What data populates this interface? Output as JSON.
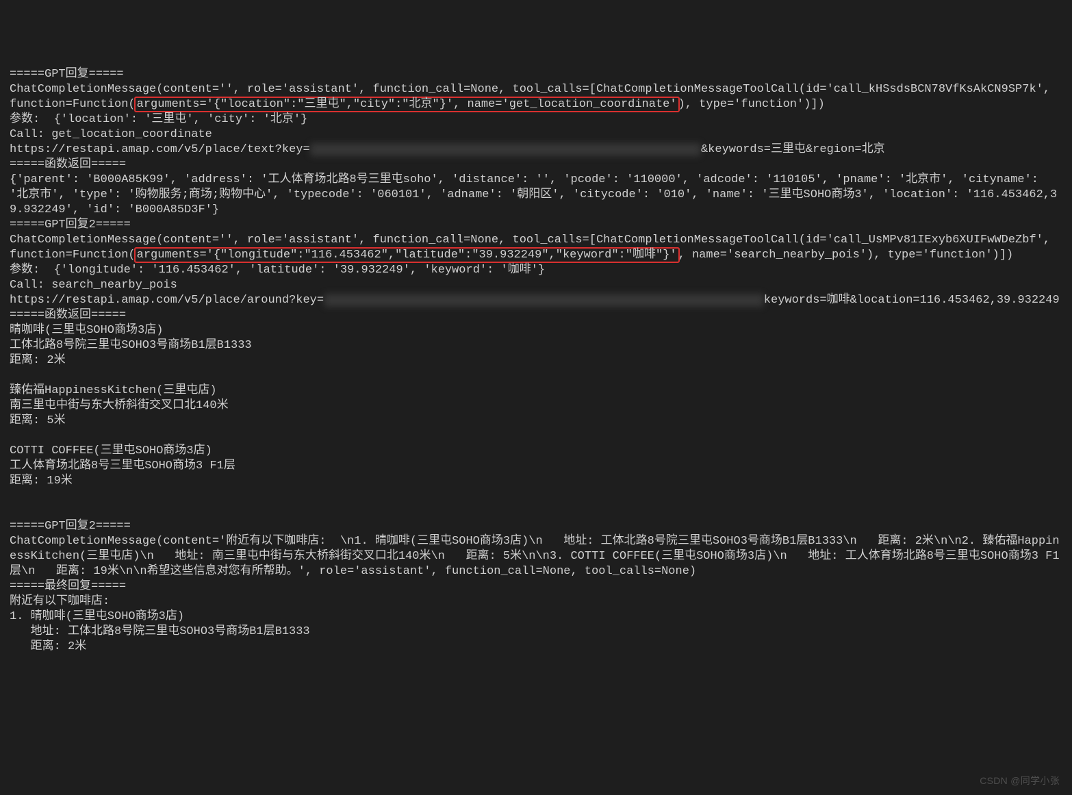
{
  "sections": {
    "gpt1_header": "=====GPT回复=====",
    "gpt1_pre": "ChatCompletionMessage(content='', role='assistant', function_call=None, tool_calls=[ChatCompletionMessageToolCall(id='call_kHSsdsBCN78VfKsAkCN9SP7k', function=Function(",
    "gpt1_hl": "arguments='{\"location\":\"三里屯\",\"city\":\"北京\"}', name='get_location_coordinate'",
    "gpt1_post": "), type='function')])",
    "params1": "参数:  {'location': '三里屯', 'city': '北京'}",
    "call1": "Call: get_location_coordinate",
    "url1_pre": "https://restapi.amap.com/v5/place/text?key=",
    "url1_blur": "xxxxxxxxxxxxxxxxxxxxxxxxxxxxxxxxxxxxxxxxxxxxxxxxxxxxx742",
    "url1_post": "&keywords=三里屯&region=北京",
    "fret1_header": "=====函数返回=====",
    "fret1_body": "{'parent': 'B000A85K99', 'address': '工人体育场北路8号三里屯soho', 'distance': '', 'pcode': '110000', 'adcode': '110105', 'pname': '北京市', 'cityname': '北京市', 'type': '购物服务;商场;购物中心', 'typecode': '060101', 'adname': '朝阳区', 'citycode': '010', 'name': '三里屯SOHO商场3', 'location': '116.453462,39.932249', 'id': 'B000A85D3F'}",
    "gpt2_header": "=====GPT回复2=====",
    "gpt2_pre": "ChatCompletionMessage(content='', role='assistant', function_call=None, tool_calls=[ChatCompletionMessageToolCall(id='call_UsMPv81IExyb6XUIFwWDeZbf', function=Function(",
    "gpt2_hl": "arguments='{\"longitude\":\"116.453462\",\"latitude\":\"39.932249\",\"keyword\":\"咖啡\"}'",
    "gpt2_post": ", name='search_nearby_pois'), type='function')])",
    "params2": "参数:  {'longitude': '116.453462', 'latitude': '39.932249', 'keyword': '咖啡'}",
    "call2": "Call: search_nearby_pois",
    "url2_pre": "https://restapi.amap.com/v5/place/around?key=",
    "url2_blur": "xxxxxxxxxxxxxxxxxxxxxxxxxxxxxxxxxxxxxxxxxxxxxxxxxxxxxxxxxxxxxxx",
    "url2_post": "keywords=咖啡&location=116.453462,39.932249",
    "fret2_header": "=====函数返回=====",
    "poi1_name": "晴咖啡(三里屯SOHO商场3店)",
    "poi1_addr": "工体北路8号院三里屯SOHO3号商场B1层B1333",
    "poi1_dist": "距离: 2米",
    "poi2_name": "臻佑福HappinessKitchen(三里屯店)",
    "poi2_addr": "南三里屯中街与东大桥斜街交叉口北140米",
    "poi2_dist": "距离: 5米",
    "poi3_name": "COTTI COFFEE(三里屯SOHO商场3店)",
    "poi3_addr": "工人体育场北路8号三里屯SOHO商场3 F1层",
    "poi3_dist": "距离: 19米",
    "gpt3_header": "=====GPT回复2=====",
    "gpt3_body": "ChatCompletionMessage(content='附近有以下咖啡店:  \\n1. 晴咖啡(三里屯SOHO商场3店)\\n   地址: 工体北路8号院三里屯SOHO3号商场B1层B1333\\n   距离: 2米\\n\\n2. 臻佑福HappinessKitchen(三里屯店)\\n   地址: 南三里屯中街与东大桥斜街交叉口北140米\\n   距离: 5米\\n\\n3. COTTI COFFEE(三里屯SOHO商场3店)\\n   地址: 工人体育场北路8号三里屯SOHO商场3 F1层\\n   距离: 19米\\n\\n希望这些信息对您有所帮助。', role='assistant', function_call=None, tool_calls=None)",
    "final_header": "=====最终回复=====",
    "final_1": "附近有以下咖啡店:",
    "final_2": "1. 晴咖啡(三里屯SOHO商场3店)",
    "final_3": "   地址: 工体北路8号院三里屯SOHO3号商场B1层B1333",
    "final_4": "   距离: 2米"
  },
  "watermark": "CSDN @同学小张"
}
